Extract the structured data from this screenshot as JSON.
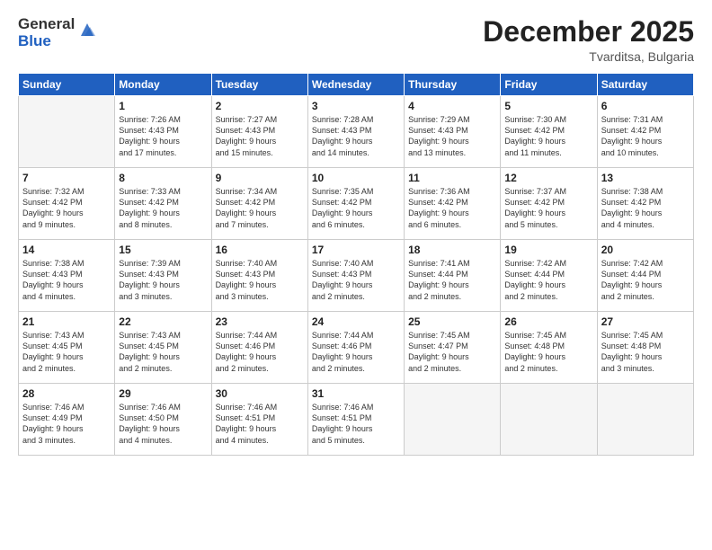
{
  "logo": {
    "general": "General",
    "blue": "Blue"
  },
  "title": "December 2025",
  "subtitle": "Tvarditsa, Bulgaria",
  "headers": [
    "Sunday",
    "Monday",
    "Tuesday",
    "Wednesday",
    "Thursday",
    "Friday",
    "Saturday"
  ],
  "weeks": [
    [
      {
        "num": "",
        "info": ""
      },
      {
        "num": "1",
        "info": "Sunrise: 7:26 AM\nSunset: 4:43 PM\nDaylight: 9 hours\nand 17 minutes."
      },
      {
        "num": "2",
        "info": "Sunrise: 7:27 AM\nSunset: 4:43 PM\nDaylight: 9 hours\nand 15 minutes."
      },
      {
        "num": "3",
        "info": "Sunrise: 7:28 AM\nSunset: 4:43 PM\nDaylight: 9 hours\nand 14 minutes."
      },
      {
        "num": "4",
        "info": "Sunrise: 7:29 AM\nSunset: 4:43 PM\nDaylight: 9 hours\nand 13 minutes."
      },
      {
        "num": "5",
        "info": "Sunrise: 7:30 AM\nSunset: 4:42 PM\nDaylight: 9 hours\nand 11 minutes."
      },
      {
        "num": "6",
        "info": "Sunrise: 7:31 AM\nSunset: 4:42 PM\nDaylight: 9 hours\nand 10 minutes."
      }
    ],
    [
      {
        "num": "7",
        "info": "Sunrise: 7:32 AM\nSunset: 4:42 PM\nDaylight: 9 hours\nand 9 minutes."
      },
      {
        "num": "8",
        "info": "Sunrise: 7:33 AM\nSunset: 4:42 PM\nDaylight: 9 hours\nand 8 minutes."
      },
      {
        "num": "9",
        "info": "Sunrise: 7:34 AM\nSunset: 4:42 PM\nDaylight: 9 hours\nand 7 minutes."
      },
      {
        "num": "10",
        "info": "Sunrise: 7:35 AM\nSunset: 4:42 PM\nDaylight: 9 hours\nand 6 minutes."
      },
      {
        "num": "11",
        "info": "Sunrise: 7:36 AM\nSunset: 4:42 PM\nDaylight: 9 hours\nand 6 minutes."
      },
      {
        "num": "12",
        "info": "Sunrise: 7:37 AM\nSunset: 4:42 PM\nDaylight: 9 hours\nand 5 minutes."
      },
      {
        "num": "13",
        "info": "Sunrise: 7:38 AM\nSunset: 4:42 PM\nDaylight: 9 hours\nand 4 minutes."
      }
    ],
    [
      {
        "num": "14",
        "info": "Sunrise: 7:38 AM\nSunset: 4:43 PM\nDaylight: 9 hours\nand 4 minutes."
      },
      {
        "num": "15",
        "info": "Sunrise: 7:39 AM\nSunset: 4:43 PM\nDaylight: 9 hours\nand 3 minutes."
      },
      {
        "num": "16",
        "info": "Sunrise: 7:40 AM\nSunset: 4:43 PM\nDaylight: 9 hours\nand 3 minutes."
      },
      {
        "num": "17",
        "info": "Sunrise: 7:40 AM\nSunset: 4:43 PM\nDaylight: 9 hours\nand 2 minutes."
      },
      {
        "num": "18",
        "info": "Sunrise: 7:41 AM\nSunset: 4:44 PM\nDaylight: 9 hours\nand 2 minutes."
      },
      {
        "num": "19",
        "info": "Sunrise: 7:42 AM\nSunset: 4:44 PM\nDaylight: 9 hours\nand 2 minutes."
      },
      {
        "num": "20",
        "info": "Sunrise: 7:42 AM\nSunset: 4:44 PM\nDaylight: 9 hours\nand 2 minutes."
      }
    ],
    [
      {
        "num": "21",
        "info": "Sunrise: 7:43 AM\nSunset: 4:45 PM\nDaylight: 9 hours\nand 2 minutes."
      },
      {
        "num": "22",
        "info": "Sunrise: 7:43 AM\nSunset: 4:45 PM\nDaylight: 9 hours\nand 2 minutes."
      },
      {
        "num": "23",
        "info": "Sunrise: 7:44 AM\nSunset: 4:46 PM\nDaylight: 9 hours\nand 2 minutes."
      },
      {
        "num": "24",
        "info": "Sunrise: 7:44 AM\nSunset: 4:46 PM\nDaylight: 9 hours\nand 2 minutes."
      },
      {
        "num": "25",
        "info": "Sunrise: 7:45 AM\nSunset: 4:47 PM\nDaylight: 9 hours\nand 2 minutes."
      },
      {
        "num": "26",
        "info": "Sunrise: 7:45 AM\nSunset: 4:48 PM\nDaylight: 9 hours\nand 2 minutes."
      },
      {
        "num": "27",
        "info": "Sunrise: 7:45 AM\nSunset: 4:48 PM\nDaylight: 9 hours\nand 3 minutes."
      }
    ],
    [
      {
        "num": "28",
        "info": "Sunrise: 7:46 AM\nSunset: 4:49 PM\nDaylight: 9 hours\nand 3 minutes."
      },
      {
        "num": "29",
        "info": "Sunrise: 7:46 AM\nSunset: 4:50 PM\nDaylight: 9 hours\nand 4 minutes."
      },
      {
        "num": "30",
        "info": "Sunrise: 7:46 AM\nSunset: 4:51 PM\nDaylight: 9 hours\nand 4 minutes."
      },
      {
        "num": "31",
        "info": "Sunrise: 7:46 AM\nSunset: 4:51 PM\nDaylight: 9 hours\nand 5 minutes."
      },
      {
        "num": "",
        "info": ""
      },
      {
        "num": "",
        "info": ""
      },
      {
        "num": "",
        "info": ""
      }
    ]
  ]
}
